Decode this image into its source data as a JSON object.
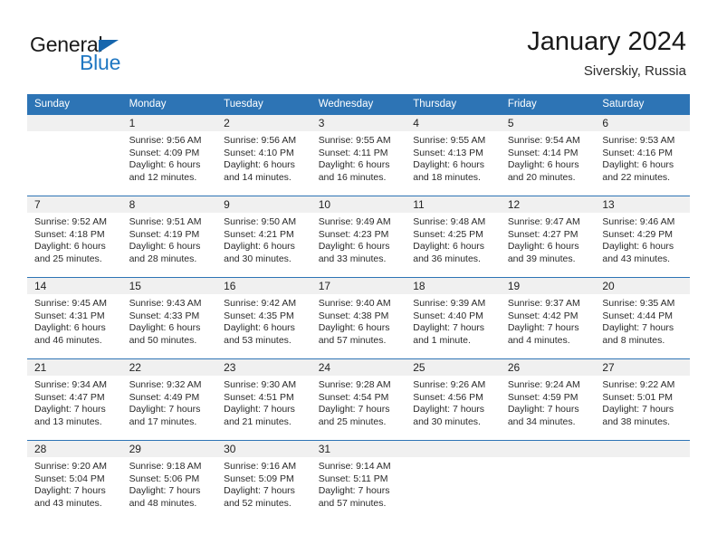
{
  "brand": {
    "word_one": "General",
    "word_two": "Blue",
    "triangle_icon": "brand-triangle-icon"
  },
  "header": {
    "title": "January 2024",
    "subtitle": "Siverskiy, Russia"
  },
  "colors": {
    "header_blue": "#2d74b5",
    "daynum_band": "#f0f0f0",
    "brand_blue": "#1f77c2",
    "text": "#222222"
  },
  "calendar": {
    "weekday_headers": [
      "Sunday",
      "Monday",
      "Tuesday",
      "Wednesday",
      "Thursday",
      "Friday",
      "Saturday"
    ],
    "weeks": [
      [
        {
          "day": "",
          "sunrise": "",
          "sunset": "",
          "daylight_line1": "",
          "daylight_line2": ""
        },
        {
          "day": "1",
          "sunrise": "Sunrise: 9:56 AM",
          "sunset": "Sunset: 4:09 PM",
          "daylight_line1": "Daylight: 6 hours",
          "daylight_line2": "and 12 minutes."
        },
        {
          "day": "2",
          "sunrise": "Sunrise: 9:56 AM",
          "sunset": "Sunset: 4:10 PM",
          "daylight_line1": "Daylight: 6 hours",
          "daylight_line2": "and 14 minutes."
        },
        {
          "day": "3",
          "sunrise": "Sunrise: 9:55 AM",
          "sunset": "Sunset: 4:11 PM",
          "daylight_line1": "Daylight: 6 hours",
          "daylight_line2": "and 16 minutes."
        },
        {
          "day": "4",
          "sunrise": "Sunrise: 9:55 AM",
          "sunset": "Sunset: 4:13 PM",
          "daylight_line1": "Daylight: 6 hours",
          "daylight_line2": "and 18 minutes."
        },
        {
          "day": "5",
          "sunrise": "Sunrise: 9:54 AM",
          "sunset": "Sunset: 4:14 PM",
          "daylight_line1": "Daylight: 6 hours",
          "daylight_line2": "and 20 minutes."
        },
        {
          "day": "6",
          "sunrise": "Sunrise: 9:53 AM",
          "sunset": "Sunset: 4:16 PM",
          "daylight_line1": "Daylight: 6 hours",
          "daylight_line2": "and 22 minutes."
        }
      ],
      [
        {
          "day": "7",
          "sunrise": "Sunrise: 9:52 AM",
          "sunset": "Sunset: 4:18 PM",
          "daylight_line1": "Daylight: 6 hours",
          "daylight_line2": "and 25 minutes."
        },
        {
          "day": "8",
          "sunrise": "Sunrise: 9:51 AM",
          "sunset": "Sunset: 4:19 PM",
          "daylight_line1": "Daylight: 6 hours",
          "daylight_line2": "and 28 minutes."
        },
        {
          "day": "9",
          "sunrise": "Sunrise: 9:50 AM",
          "sunset": "Sunset: 4:21 PM",
          "daylight_line1": "Daylight: 6 hours",
          "daylight_line2": "and 30 minutes."
        },
        {
          "day": "10",
          "sunrise": "Sunrise: 9:49 AM",
          "sunset": "Sunset: 4:23 PM",
          "daylight_line1": "Daylight: 6 hours",
          "daylight_line2": "and 33 minutes."
        },
        {
          "day": "11",
          "sunrise": "Sunrise: 9:48 AM",
          "sunset": "Sunset: 4:25 PM",
          "daylight_line1": "Daylight: 6 hours",
          "daylight_line2": "and 36 minutes."
        },
        {
          "day": "12",
          "sunrise": "Sunrise: 9:47 AM",
          "sunset": "Sunset: 4:27 PM",
          "daylight_line1": "Daylight: 6 hours",
          "daylight_line2": "and 39 minutes."
        },
        {
          "day": "13",
          "sunrise": "Sunrise: 9:46 AM",
          "sunset": "Sunset: 4:29 PM",
          "daylight_line1": "Daylight: 6 hours",
          "daylight_line2": "and 43 minutes."
        }
      ],
      [
        {
          "day": "14",
          "sunrise": "Sunrise: 9:45 AM",
          "sunset": "Sunset: 4:31 PM",
          "daylight_line1": "Daylight: 6 hours",
          "daylight_line2": "and 46 minutes."
        },
        {
          "day": "15",
          "sunrise": "Sunrise: 9:43 AM",
          "sunset": "Sunset: 4:33 PM",
          "daylight_line1": "Daylight: 6 hours",
          "daylight_line2": "and 50 minutes."
        },
        {
          "day": "16",
          "sunrise": "Sunrise: 9:42 AM",
          "sunset": "Sunset: 4:35 PM",
          "daylight_line1": "Daylight: 6 hours",
          "daylight_line2": "and 53 minutes."
        },
        {
          "day": "17",
          "sunrise": "Sunrise: 9:40 AM",
          "sunset": "Sunset: 4:38 PM",
          "daylight_line1": "Daylight: 6 hours",
          "daylight_line2": "and 57 minutes."
        },
        {
          "day": "18",
          "sunrise": "Sunrise: 9:39 AM",
          "sunset": "Sunset: 4:40 PM",
          "daylight_line1": "Daylight: 7 hours",
          "daylight_line2": "and 1 minute."
        },
        {
          "day": "19",
          "sunrise": "Sunrise: 9:37 AM",
          "sunset": "Sunset: 4:42 PM",
          "daylight_line1": "Daylight: 7 hours",
          "daylight_line2": "and 4 minutes."
        },
        {
          "day": "20",
          "sunrise": "Sunrise: 9:35 AM",
          "sunset": "Sunset: 4:44 PM",
          "daylight_line1": "Daylight: 7 hours",
          "daylight_line2": "and 8 minutes."
        }
      ],
      [
        {
          "day": "21",
          "sunrise": "Sunrise: 9:34 AM",
          "sunset": "Sunset: 4:47 PM",
          "daylight_line1": "Daylight: 7 hours",
          "daylight_line2": "and 13 minutes."
        },
        {
          "day": "22",
          "sunrise": "Sunrise: 9:32 AM",
          "sunset": "Sunset: 4:49 PM",
          "daylight_line1": "Daylight: 7 hours",
          "daylight_line2": "and 17 minutes."
        },
        {
          "day": "23",
          "sunrise": "Sunrise: 9:30 AM",
          "sunset": "Sunset: 4:51 PM",
          "daylight_line1": "Daylight: 7 hours",
          "daylight_line2": "and 21 minutes."
        },
        {
          "day": "24",
          "sunrise": "Sunrise: 9:28 AM",
          "sunset": "Sunset: 4:54 PM",
          "daylight_line1": "Daylight: 7 hours",
          "daylight_line2": "and 25 minutes."
        },
        {
          "day": "25",
          "sunrise": "Sunrise: 9:26 AM",
          "sunset": "Sunset: 4:56 PM",
          "daylight_line1": "Daylight: 7 hours",
          "daylight_line2": "and 30 minutes."
        },
        {
          "day": "26",
          "sunrise": "Sunrise: 9:24 AM",
          "sunset": "Sunset: 4:59 PM",
          "daylight_line1": "Daylight: 7 hours",
          "daylight_line2": "and 34 minutes."
        },
        {
          "day": "27",
          "sunrise": "Sunrise: 9:22 AM",
          "sunset": "Sunset: 5:01 PM",
          "daylight_line1": "Daylight: 7 hours",
          "daylight_line2": "and 38 minutes."
        }
      ],
      [
        {
          "day": "28",
          "sunrise": "Sunrise: 9:20 AM",
          "sunset": "Sunset: 5:04 PM",
          "daylight_line1": "Daylight: 7 hours",
          "daylight_line2": "and 43 minutes."
        },
        {
          "day": "29",
          "sunrise": "Sunrise: 9:18 AM",
          "sunset": "Sunset: 5:06 PM",
          "daylight_line1": "Daylight: 7 hours",
          "daylight_line2": "and 48 minutes."
        },
        {
          "day": "30",
          "sunrise": "Sunrise: 9:16 AM",
          "sunset": "Sunset: 5:09 PM",
          "daylight_line1": "Daylight: 7 hours",
          "daylight_line2": "and 52 minutes."
        },
        {
          "day": "31",
          "sunrise": "Sunrise: 9:14 AM",
          "sunset": "Sunset: 5:11 PM",
          "daylight_line1": "Daylight: 7 hours",
          "daylight_line2": "and 57 minutes."
        },
        {
          "day": "",
          "sunrise": "",
          "sunset": "",
          "daylight_line1": "",
          "daylight_line2": ""
        },
        {
          "day": "",
          "sunrise": "",
          "sunset": "",
          "daylight_line1": "",
          "daylight_line2": ""
        },
        {
          "day": "",
          "sunrise": "",
          "sunset": "",
          "daylight_line1": "",
          "daylight_line2": ""
        }
      ]
    ]
  }
}
